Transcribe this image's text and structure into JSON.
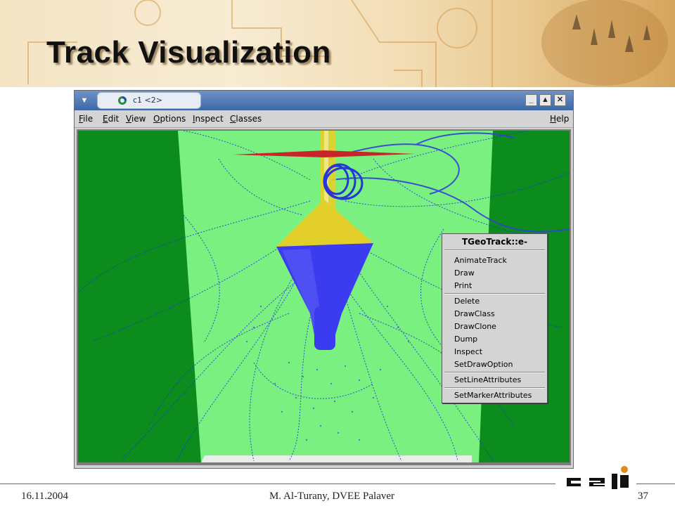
{
  "slide": {
    "title": "Track Visualization",
    "date": "16.11.2004",
    "author": "M. Al-Turany,  DVEE  Palaver",
    "page": "37",
    "logo": "GSI"
  },
  "window": {
    "title": "c1 <2>",
    "controls": [
      "minimize",
      "maximize",
      "close"
    ]
  },
  "menubar": {
    "items": [
      {
        "label": "File",
        "key": "F"
      },
      {
        "label": "Edit",
        "key": "E"
      },
      {
        "label": "View",
        "key": "V"
      },
      {
        "label": "Options",
        "key": "O"
      },
      {
        "label": "Inspect",
        "key": "I"
      },
      {
        "label": "Classes",
        "key": "C"
      }
    ],
    "help": "Help"
  },
  "context_menu": {
    "title": "TGeoTrack::e-",
    "groups": [
      [
        "AnimateTrack",
        "Draw",
        "Print"
      ],
      [
        "Delete",
        "DrawClass",
        "DrawClone",
        "Dump",
        "Inspect",
        "SetDrawOption"
      ],
      [
        "SetLineAttributes"
      ],
      [
        "SetMarkerAttributes"
      ]
    ]
  },
  "colors": {
    "background_green": "#79f080",
    "dark_green": "#0c8c1c",
    "cone_yellow": "#e3cf2a",
    "cone_blue": "#3b3cf0",
    "track_blue": "#2233dd",
    "red_bar": "#c8252b"
  }
}
